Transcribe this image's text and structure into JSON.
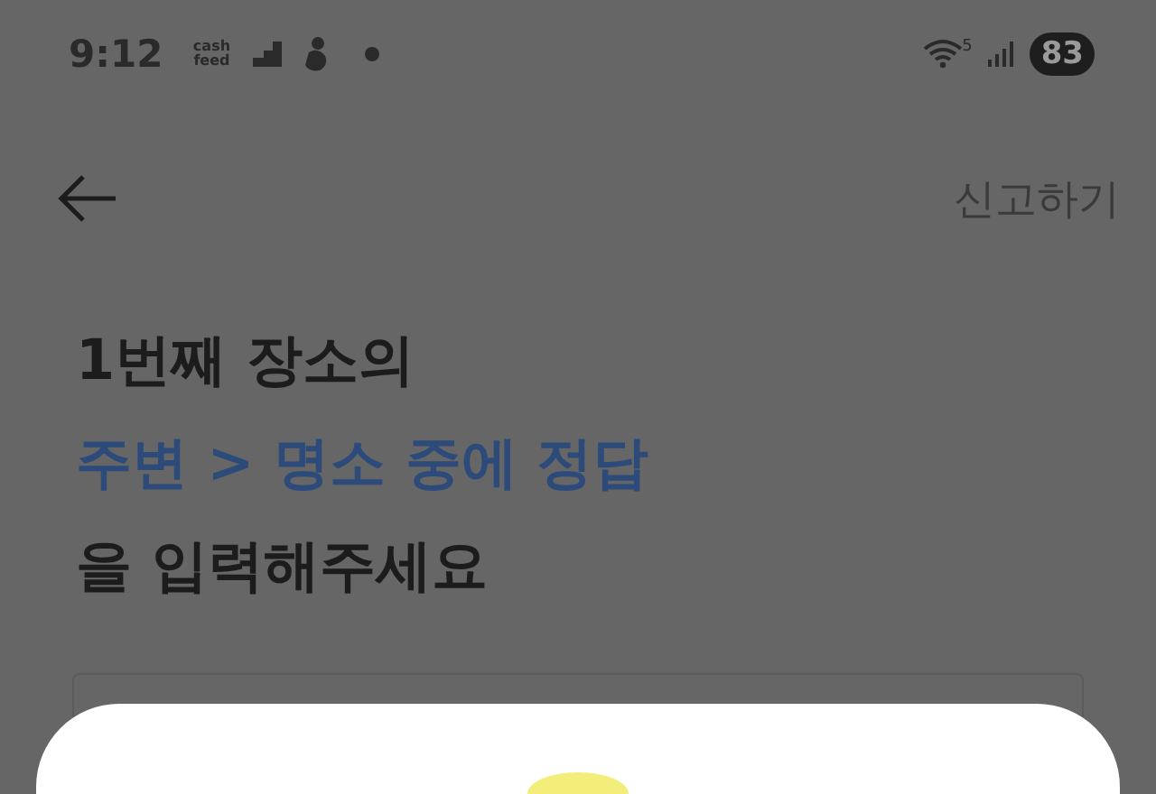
{
  "status_bar": {
    "time": "9:12",
    "app_label": "cash feed",
    "network": "5",
    "battery": "83"
  },
  "header": {
    "action": "신고하기"
  },
  "question": {
    "lines": [
      {
        "text": "1번째 장소의",
        "kind": "plain"
      },
      {
        "text": "주변 > 명소 중에 정답",
        "kind": "accent"
      },
      {
        "text": "을 입력해주세요",
        "kind": "plain"
      }
    ]
  }
}
